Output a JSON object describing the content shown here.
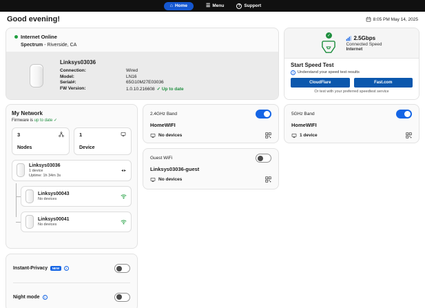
{
  "nav": {
    "items": [
      {
        "label": "Home",
        "active": true
      },
      {
        "label": "Menu",
        "active": false
      },
      {
        "label": "Support",
        "active": false
      }
    ]
  },
  "header": {
    "greeting": "Good evening!",
    "datetime": "8:05 PM May 14, 2025"
  },
  "internet_card": {
    "status": "Internet Online",
    "isp_name": "Spectrum",
    "isp_rest": "- Riverside, CA",
    "device_name": "Linksys03036",
    "fields": [
      {
        "label": "Connection:",
        "value": "Wired"
      },
      {
        "label": "Model:",
        "value": "LN16"
      },
      {
        "label": "Serial#:",
        "value": "65G10M27E03036"
      },
      {
        "label": "FW Version:",
        "value": "1.0.10.216608"
      }
    ],
    "fw_badge": "✓ Up to date"
  },
  "speed_card": {
    "speed": "2.5Gbps",
    "speed_caption": "Connected Speed",
    "speed_target": "Internet",
    "title": "Start Speed Test",
    "hint": "Understand your speed test results",
    "buttons": [
      "CloudFlare",
      "Fast.com"
    ],
    "footnote": "Or test with your preferred speedtest service"
  },
  "my_network": {
    "title": "My Network",
    "firmware_prefix": "Firmware is ",
    "firmware_status": "up to date ✓",
    "stats": [
      {
        "value": "3",
        "label": "Nodes"
      },
      {
        "value": "1",
        "label": "Device"
      }
    ],
    "parent_node": {
      "name": "Linksys03036",
      "line1": "1 device",
      "line2": "Uptime: 1h 34m 3s"
    },
    "child_nodes": [
      {
        "name": "Linksys00043",
        "line1": "No devices"
      },
      {
        "name": "Linksys00041",
        "line1": "No devices"
      }
    ]
  },
  "wifi": {
    "band24": {
      "label": "2.4GHz Band",
      "ssid": "HomeWIFI",
      "devices": "No devices",
      "enabled": true
    },
    "band5": {
      "label": "5GHz Band",
      "ssid": "HomeWIFI",
      "devices": "1 device",
      "enabled": true
    },
    "guest": {
      "label": "Guest WiFi",
      "ssid": "Linksys03036-guest",
      "devices": "No devices",
      "enabled": false
    }
  },
  "settings": {
    "privacy": {
      "label": "Instant-Privacy",
      "badge": "NEW",
      "enabled": false
    },
    "night": {
      "label": "Night mode",
      "enabled": false
    }
  },
  "icons": {
    "home": "⌂",
    "menu": "☰",
    "support": "?",
    "check": "✓",
    "wired": "◂▸"
  },
  "colors": {
    "accent_blue": "#1565e5",
    "button_blue": "#0b57ad",
    "status_green": "#1e8e3e",
    "nav_black": "#101010"
  }
}
